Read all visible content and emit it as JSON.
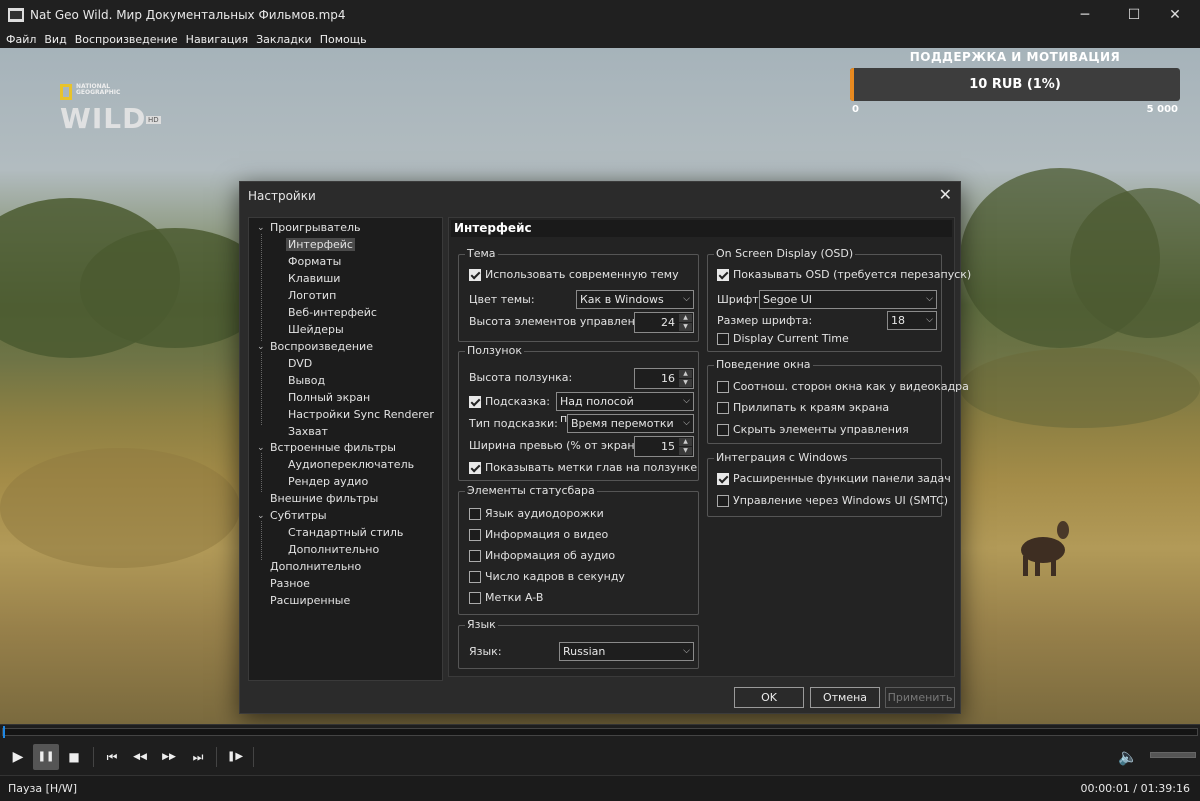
{
  "window": {
    "title": "Nat Geo Wild. Мир Документальных Фильмов.mp4",
    "minimize": "─",
    "maximize": "☐",
    "close": "✕"
  },
  "menu": [
    "Файл",
    "Вид",
    "Воспроизведение",
    "Навигация",
    "Закладки",
    "Помощь"
  ],
  "overlay": {
    "logo_small": "NATIONAL GEOGRAPHIC",
    "logo_big": "WILD",
    "logo_hd": "HD",
    "donation_title": "ПОДДЕРЖКА И МОТИВАЦИЯ",
    "donation_value": "10 RUB (1%)",
    "donation_progress": 0.01,
    "donation_min": "0",
    "donation_max": "5 000",
    "accent": "#e88a20"
  },
  "dialog": {
    "title": "Настройки",
    "close": "✕",
    "tree": [
      {
        "label": "Проигрыватель",
        "expander": "⌄"
      },
      {
        "label": "Интерфейс",
        "selected": true
      },
      {
        "label": "Форматы"
      },
      {
        "label": "Клавиши"
      },
      {
        "label": "Логотип"
      },
      {
        "label": "Веб-интерфейс"
      },
      {
        "label": "Шейдеры"
      },
      {
        "label": "Воспроизведение",
        "expander": "⌄"
      },
      {
        "label": "DVD"
      },
      {
        "label": "Вывод"
      },
      {
        "label": "Полный экран"
      },
      {
        "label": "Настройки Sync Renderer"
      },
      {
        "label": "Захват"
      },
      {
        "label": "Встроенные фильтры",
        "expander": "⌄"
      },
      {
        "label": "Аудиопереключатель"
      },
      {
        "label": "Рендер аудио"
      },
      {
        "label": "Внешние фильтры"
      },
      {
        "label": "Субтитры",
        "expander": "⌄"
      },
      {
        "label": "Стандартный стиль"
      },
      {
        "label": "Дополнительно"
      },
      {
        "label": "Дополнительно"
      },
      {
        "label": "Разное"
      },
      {
        "label": "Расширенные"
      }
    ],
    "panel_title": "Интерфейс",
    "theme": {
      "group": "Тема",
      "use_modern": "Использовать современную тему",
      "use_modern_checked": true,
      "color_label": "Цвет темы:",
      "color_value": "Как в Windows",
      "controls_height_label": "Высота элементов управления:",
      "controls_height_value": "24"
    },
    "seekbar": {
      "group": "Ползунок",
      "height_label": "Высота ползунка:",
      "height_value": "16",
      "tooltip_label": "Подсказка:",
      "tooltip_checked": true,
      "tooltip_value": "Над полосой прокрутки",
      "tooltip_type_label": "Тип подсказки:",
      "tooltip_type_value": "Время перемотки",
      "preview_width_label": "Ширина превью (% от экрана)",
      "preview_width_value": "15",
      "chapters": "Показывать метки глав на ползунке",
      "chapters_checked": true
    },
    "statusbar": {
      "group": "Элементы статусбара",
      "items": [
        {
          "label": "Язык аудиодорожки",
          "checked": false
        },
        {
          "label": "Информация о видео",
          "checked": false
        },
        {
          "label": "Информация об аудио",
          "checked": false
        },
        {
          "label": "Число кадров в секунду",
          "checked": false
        },
        {
          "label": "Метки A-B",
          "checked": false
        }
      ]
    },
    "language": {
      "group": "Язык",
      "label": "Язык:",
      "value": "Russian"
    },
    "osd": {
      "group": "On Screen Display (OSD)",
      "show": "Показывать OSD (требуется перезапуск)",
      "show_checked": true,
      "font_label": "Шрифт:",
      "font_value": "Segoe UI",
      "size_label": "Размер шрифта:",
      "size_value": "18",
      "current_time": "Display Current Time",
      "current_time_checked": false
    },
    "window_behavior": {
      "group": "Поведение окна",
      "items": [
        {
          "label": "Соотнош. сторон окна как у видеокадра",
          "checked": false
        },
        {
          "label": "Прилипать к краям экрана",
          "checked": false
        },
        {
          "label": "Скрыть элементы управления",
          "checked": false
        }
      ]
    },
    "windows_integration": {
      "group": "Интеграция с Windows",
      "items": [
        {
          "label": "Расширенные функции панели задач",
          "checked": true
        },
        {
          "label": "Управление через Windows UI (SMTC)",
          "checked": false
        }
      ]
    },
    "buttons": {
      "ok": "OK",
      "cancel": "Отмена",
      "apply": "Применить"
    }
  },
  "player": {
    "icons": {
      "play": "▶",
      "pause": "❚❚",
      "stop": "■",
      "prev": "⏮",
      "rewind": "◀◀",
      "forward": "▶▶",
      "next": "⏭",
      "frame_step": "❚▶",
      "volume": "🔈"
    },
    "pause_active": true,
    "seek_progress": 0.0001,
    "volume_level": 0.0,
    "status_text": "Пауза [H/W]",
    "time_text": "00:00:01 / 01:39:16"
  }
}
